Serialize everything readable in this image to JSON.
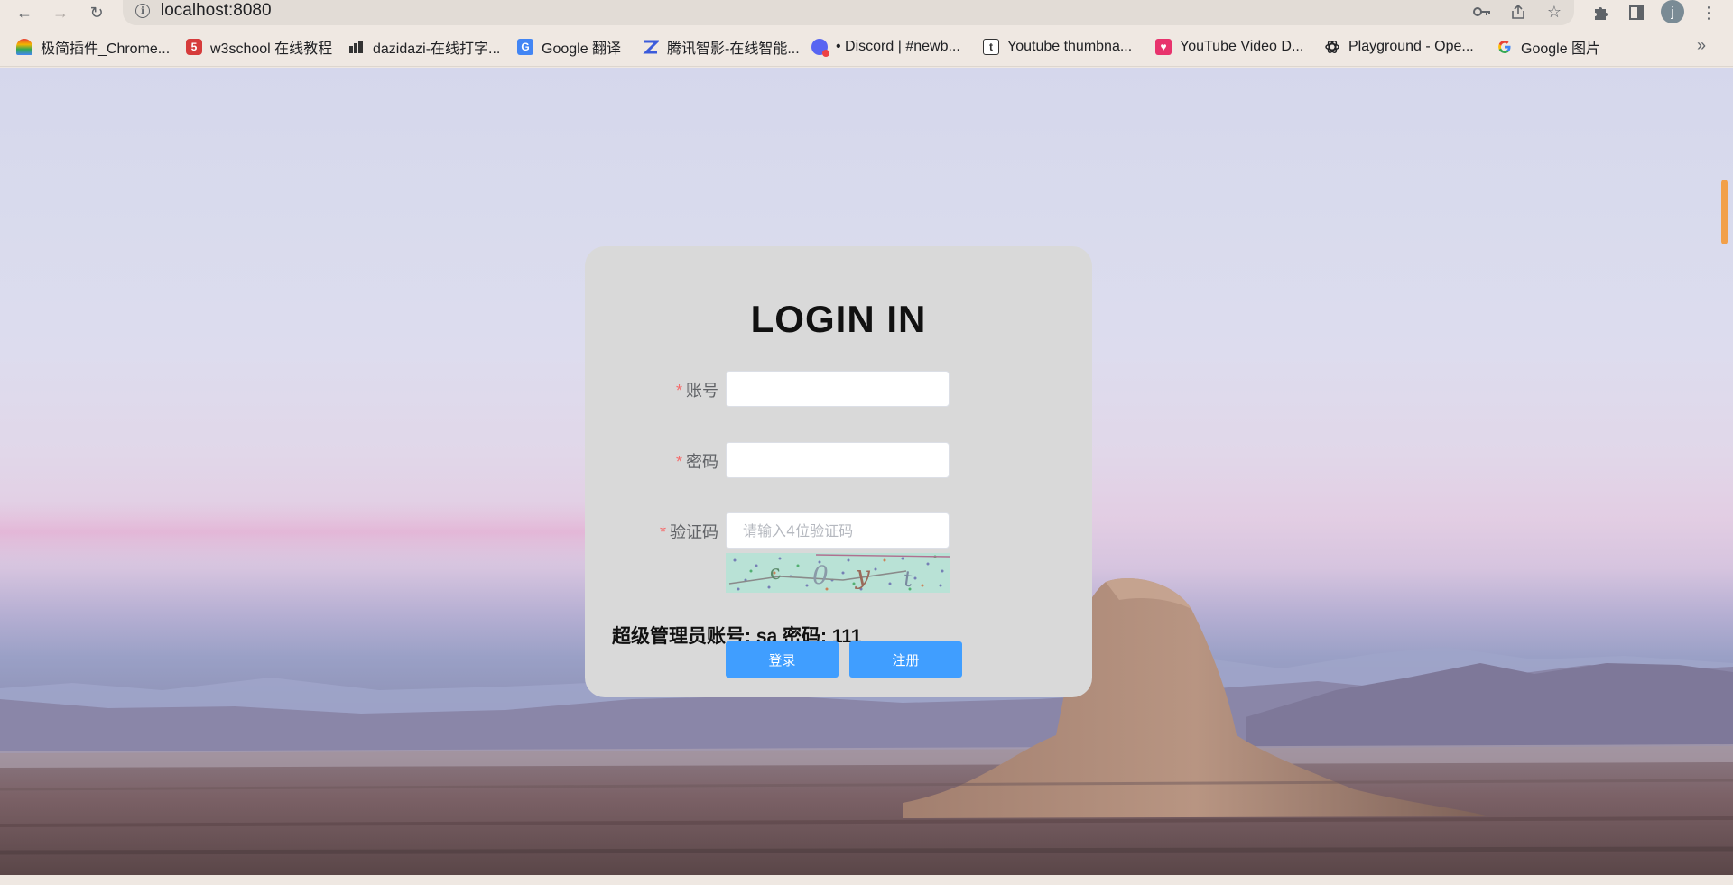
{
  "browser": {
    "url": "localhost:8080",
    "profile_initial": "j",
    "bookmarks": [
      {
        "label": "极简插件_Chrome...",
        "icon": "rainbow-icon",
        "color": "#f4b400"
      },
      {
        "label": "w3school 在线教程",
        "icon": "w3school-icon",
        "color": "#d63b3b"
      },
      {
        "label": "dazidazi-在线打字...",
        "icon": "dazidazi-icon",
        "color": "#333333"
      },
      {
        "label": "Google 翻译",
        "icon": "google-translate-icon",
        "color": "#4285f4"
      },
      {
        "label": "腾讯智影-在线智能...",
        "icon": "tencent-zhiying-icon",
        "color": "#3b5bdb"
      },
      {
        "label": "• Discord | #newb...",
        "icon": "discord-icon",
        "color": "#5865f2"
      },
      {
        "label": "Youtube thumbna...",
        "icon": "t-icon",
        "color": "#ffffff"
      },
      {
        "label": "YouTube Video D...",
        "icon": "download-heart-icon",
        "color": "#e8336d"
      },
      {
        "label": "Playground - Ope...",
        "icon": "openai-icon",
        "color": "#ffffff"
      },
      {
        "label": "Google 图片",
        "icon": "google-icon",
        "color": "#ffffff"
      }
    ]
  },
  "login": {
    "title": "LOGIN IN",
    "username_label": "账号",
    "password_label": "密码",
    "captcha_label": "验证码",
    "required_mark": "*",
    "username_value": "",
    "password_value": "",
    "captcha_placeholder": "请输入4位验证码",
    "captcha_chars": [
      "c",
      "0",
      "y",
      "t"
    ],
    "admin_hint": "超级管理员账号: sa 密码: 111",
    "login_button": "登录",
    "register_button": "注册"
  },
  "colors": {
    "primary_button": "#409eff",
    "required_mark": "#f56c6c",
    "card_bg": "#d9d9d9",
    "scrollbar": "#f2a049"
  }
}
